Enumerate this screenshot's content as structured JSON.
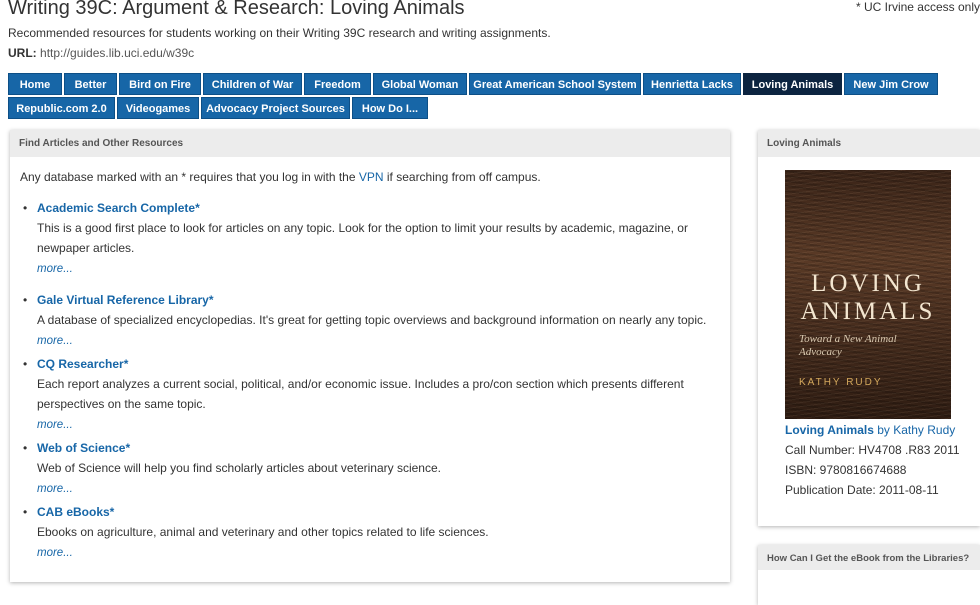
{
  "header": {
    "title": "Writing 39C: Argument & Research: Loving Animals",
    "access_note": "* UC Irvine access only",
    "description": "Recommended resources for students working on their Writing 39C research and writing assignments.",
    "url_label": "URL:",
    "url": "http://guides.lib.uci.edu/w39c"
  },
  "tabs": [
    {
      "label": "Home"
    },
    {
      "label": "Better"
    },
    {
      "label": "Bird on Fire"
    },
    {
      "label": "Children of War"
    },
    {
      "label": "Freedom"
    },
    {
      "label": "Global Woman"
    },
    {
      "label": "Great American School System"
    },
    {
      "label": "Henrietta Lacks"
    },
    {
      "label": "Loving Animals",
      "active": true
    },
    {
      "label": "New Jim Crow"
    },
    {
      "label": "Republic.com 2.0"
    },
    {
      "label": "Videogames"
    },
    {
      "label": "Advocacy Project Sources"
    },
    {
      "label": "How Do I..."
    }
  ],
  "main": {
    "header": "Find Articles and Other Resources",
    "vpn_note_before": "Any database marked with an * requires that you log in with the ",
    "vpn_link": "VPN",
    "vpn_note_after": " if searching from off campus.",
    "resources": [
      {
        "title": "Academic Search Complete*",
        "description": "This is a good first place to look for articles on any topic. Look for the option to limit your results by academic, magazine, or newpaper articles.",
        "more": "more..."
      },
      {
        "title": "Gale Virtual Reference Library*",
        "description": "A database of specialized encyclopedias. It's great for getting topic overviews and background information on nearly any topic.",
        "more": "more..."
      },
      {
        "title": "CQ Researcher*",
        "description": "Each report analyzes a current social, political, and/or economic issue. Includes a pro/con section which presents different perspectives on the same topic.",
        "more": "more..."
      },
      {
        "title": "Web of Science*",
        "description": "Web of Science will help you find scholarly articles about veterinary science.",
        "more": "more..."
      },
      {
        "title": "CAB eBooks*",
        "description": "Ebooks on agriculture, animal and veterinary and other topics related to life sciences.",
        "more": "more..."
      }
    ]
  },
  "sidebar": {
    "header": "Loving Animals",
    "cover": {
      "title_line1": "LOVING",
      "title_line2": "ANIMALS",
      "subtitle": "Toward a New Animal Advocacy",
      "author": "KATHY RUDY"
    },
    "book_title": "Loving Animals",
    "book_by": " by Kathy Rudy",
    "call_number": "Call Number: HV4708 .R83 2011",
    "isbn": "ISBN: 9780816674688",
    "pub_date": "Publication Date: 2011-08-11",
    "box2_header": "How Can I Get the eBook from the Libraries?"
  },
  "colors": {
    "tab": "#1766a7",
    "tab_active": "#0c2440",
    "link": "#1766a7",
    "panel_header_bg": "#ececec"
  }
}
